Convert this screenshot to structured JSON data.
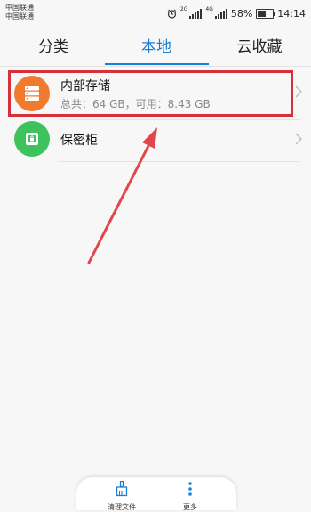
{
  "status_bar": {
    "carrier_1": "中国联通",
    "carrier_2": "中国联通",
    "net_1": "2G",
    "net_2": "4G",
    "battery": "58%",
    "battery_level": 0.58,
    "time": "14:14"
  },
  "tabs": [
    {
      "label": "分类",
      "active": false
    },
    {
      "label": "本地",
      "active": true
    },
    {
      "label": "云收藏",
      "active": false
    }
  ],
  "storage_items": [
    {
      "title": "内部存储",
      "subtitle": "总共：64 GB，可用：8.43 GB",
      "icon": "storage-icon",
      "color": "#f07a2e"
    },
    {
      "title": "保密柜",
      "icon": "safe-icon",
      "color": "#3ec25b"
    }
  ],
  "bottom_bar": {
    "clean_label": "清理文件",
    "clean_icon": "broom-icon",
    "more_label": "更多",
    "more_icon": "more-vertical-icon"
  },
  "colors": {
    "accent": "#1a7fd4",
    "annotation": "#d63038"
  }
}
